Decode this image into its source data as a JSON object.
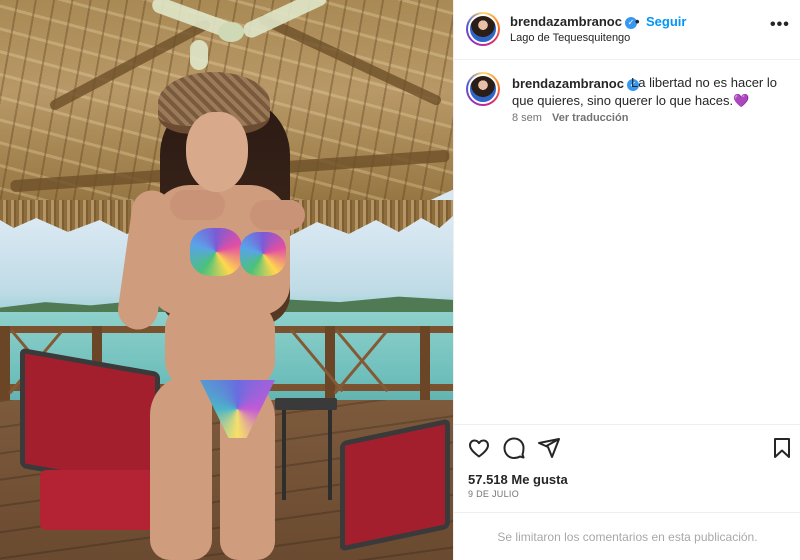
{
  "post": {
    "username": "brendazambranoc",
    "verified": true,
    "separator": "•",
    "follow_label": "Seguir",
    "location": "Lago de Tequesquitengo",
    "more_icon": "more-horizontal-icon",
    "caption": {
      "username": "brendazambranoc",
      "text": "La libertad no es hacer lo que quieres, sino querer lo que haces.",
      "emoji": "💜",
      "age": "8 sem",
      "translate_label": "Ver traducción"
    },
    "actions": {
      "like_icon": "heart-icon",
      "comment_icon": "comment-icon",
      "share_icon": "share-icon",
      "save_icon": "bookmark-icon"
    },
    "likes_label": "57.518 Me gusta",
    "date": "9 DE JULIO",
    "comments_limited": "Se limitaron los comentarios en esta publicación."
  },
  "colors": {
    "link_blue": "#0095f6",
    "verified_blue": "#3897f0",
    "secondary_text": "#737373",
    "divider": "#efefef"
  }
}
